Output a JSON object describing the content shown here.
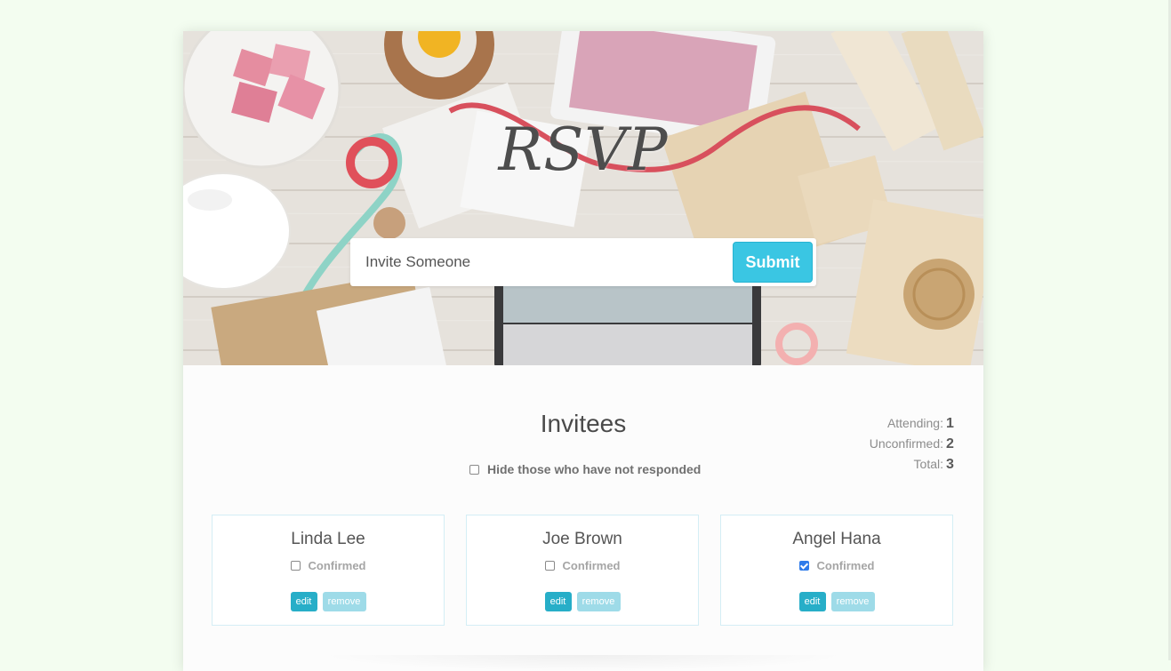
{
  "header": {
    "title": "RSVP",
    "invite_placeholder": "Invite Someone",
    "submit_label": "Submit"
  },
  "main": {
    "heading": "Invitees",
    "filter_label": "Hide those who have not responded",
    "filter_checked": false
  },
  "counter": {
    "attending_label": "Attending:",
    "attending_value": "1",
    "unconfirmed_label": "Unconfirmed:",
    "unconfirmed_value": "2",
    "total_label": "Total:",
    "total_value": "3"
  },
  "invitees": [
    {
      "name": "Linda Lee",
      "confirmed_label": "Confirmed",
      "confirmed": false,
      "edit_label": "edit",
      "remove_label": "remove"
    },
    {
      "name": "Joe Brown",
      "confirmed_label": "Confirmed",
      "confirmed": false,
      "edit_label": "edit",
      "remove_label": "remove"
    },
    {
      "name": "Angel Hana",
      "confirmed_label": "Confirmed",
      "confirmed": true,
      "edit_label": "edit",
      "remove_label": "remove"
    }
  ],
  "colors": {
    "accent": "#3ac6e3",
    "edit_button": "#27aec8",
    "remove_button": "#9edbe8",
    "page_background": "#f3fdf0"
  }
}
